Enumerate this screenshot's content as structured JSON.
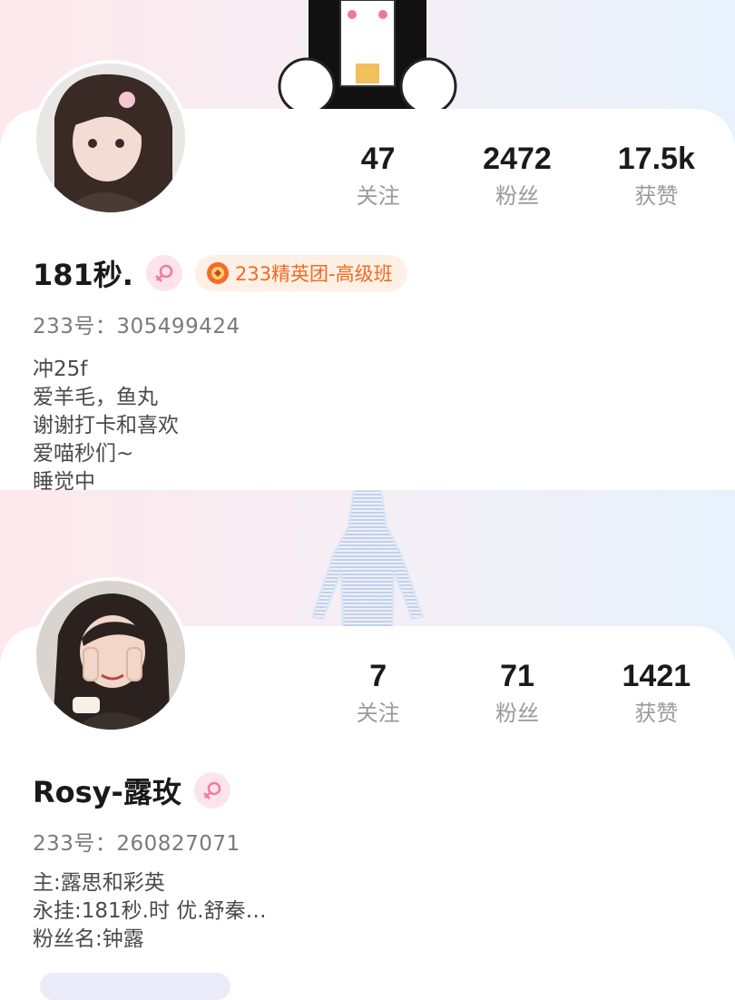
{
  "profiles": [
    {
      "stats": [
        {
          "value": "47",
          "label": "关注"
        },
        {
          "value": "2472",
          "label": "粉丝"
        },
        {
          "value": "17.5k",
          "label": "获赞"
        }
      ],
      "username": "181秒.",
      "gender_icon": "female-icon",
      "badge": {
        "icon": "medal-icon",
        "text": "233精英团-高级班"
      },
      "id_line": "233号：305499424",
      "bio": [
        "冲25f",
        "爱羊毛，鱼丸",
        "谢谢打卡和喜欢",
        "爱喵秒们~",
        "睡觉中"
      ]
    },
    {
      "stats": [
        {
          "value": "7",
          "label": "关注"
        },
        {
          "value": "71",
          "label": "粉丝"
        },
        {
          "value": "1421",
          "label": "获赞"
        }
      ],
      "username": "Rosy-露玫",
      "gender_icon": "female-icon",
      "id_line": "233号：260827071",
      "bio": [
        "主:露思和彩英",
        "永挂:181秒.时 优.舒秦…",
        "粉丝名:钟露"
      ]
    }
  ],
  "colors": {
    "accent_female": "#f37aa3",
    "badge_text": "#f06a1f",
    "muted": "#9a9a9a"
  }
}
